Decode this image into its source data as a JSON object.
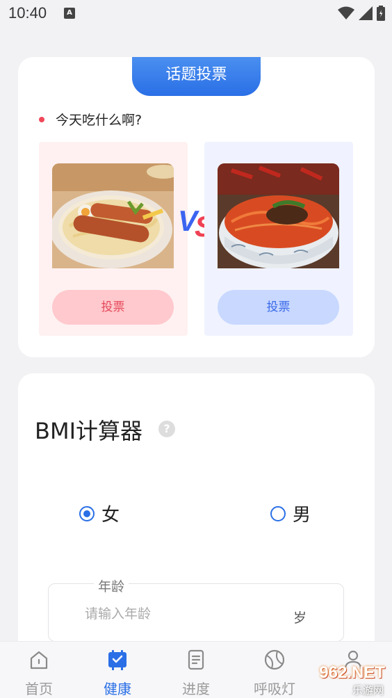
{
  "status_bar": {
    "time": "10:40",
    "notification_icon": "a-icon",
    "wifi_icon": "wifi-icon",
    "signal_icon": "signal-icon",
    "battery_icon": "battery-icon"
  },
  "vote": {
    "tab_title": "话题投票",
    "question": "今天吃什么啊?",
    "vs_v": "V",
    "vs_s": "S",
    "left_option": {
      "image": "sausage-ramen-image",
      "vote_label": "投票"
    },
    "right_option": {
      "image": "spicy-noodles-image",
      "vote_label": "投票"
    },
    "colors": {
      "accent_blue": "#2a6fe6",
      "accent_red": "#ef4155"
    }
  },
  "bmi": {
    "title": "BMI计算器",
    "help_icon": "?",
    "gender": {
      "female_label": "女",
      "male_label": "男",
      "selected": "女"
    },
    "age": {
      "label": "年龄",
      "placeholder": "请输入年龄",
      "value": "",
      "unit": "岁"
    }
  },
  "bottom_nav": {
    "items": [
      {
        "label": "首页",
        "icon": "home-icon",
        "active": false
      },
      {
        "label": "健康",
        "icon": "health-calendar-icon",
        "active": true
      },
      {
        "label": "进度",
        "icon": "progress-document-icon",
        "active": false
      },
      {
        "label": "呼吸灯",
        "icon": "ball-icon",
        "active": false
      },
      {
        "label": "",
        "icon": "profile-icon",
        "active": false
      }
    ]
  },
  "watermark": {
    "logo": "962.NET",
    "sub": "乐游网"
  }
}
